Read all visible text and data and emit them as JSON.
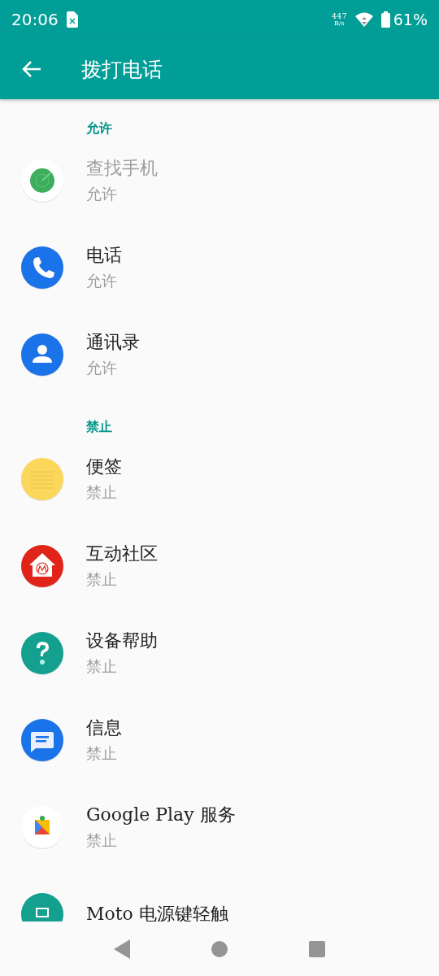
{
  "status_bar": {
    "time": "20:06",
    "net_speed_value": "447",
    "net_speed_unit": "B/s",
    "battery": "61%"
  },
  "app_bar": {
    "title": "拨打电话"
  },
  "sections": [
    {
      "header": "允许",
      "items": [
        {
          "kind": "radar",
          "title": "查找手机",
          "status": "允许",
          "disabled": true
        },
        {
          "kind": "phone",
          "title": "电话",
          "status": "允许",
          "disabled": false
        },
        {
          "kind": "contacts",
          "title": "通讯录",
          "status": "允许",
          "disabled": false
        }
      ]
    },
    {
      "header": "禁止",
      "items": [
        {
          "kind": "notes",
          "title": "便签",
          "status": "禁止",
          "disabled": false
        },
        {
          "kind": "community",
          "title": "互动社区",
          "status": "禁止",
          "disabled": false
        },
        {
          "kind": "help",
          "title": "设备帮助",
          "status": "禁止",
          "disabled": false
        },
        {
          "kind": "messages",
          "title": "信息",
          "status": "禁止",
          "disabled": false
        },
        {
          "kind": "puzzle",
          "title": "Google Play 服务",
          "status": "禁止",
          "disabled": false
        },
        {
          "kind": "power",
          "title": "Moto 电源键轻触",
          "disabled": false
        }
      ]
    }
  ]
}
